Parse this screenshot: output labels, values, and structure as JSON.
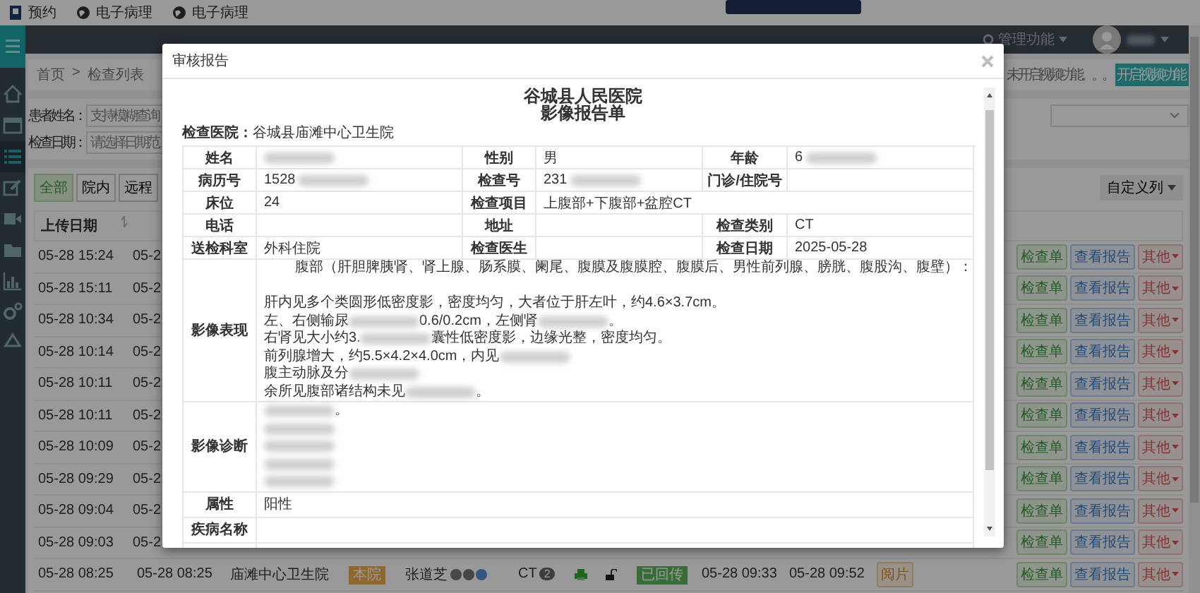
{
  "browser_bar": {
    "bookmarks": [
      {
        "kind": "app",
        "label": "预约"
      },
      {
        "kind": "globe",
        "label": "电子病理"
      },
      {
        "kind": "globe",
        "label": "电子病理"
      }
    ]
  },
  "header": {
    "menu": "管理功能"
  },
  "sidebar": {
    "items": [
      {
        "kind": "home",
        "selected": false
      },
      {
        "kind": "window",
        "selected": false
      },
      {
        "kind": "list",
        "selected": true
      },
      {
        "kind": "edit",
        "selected": false
      },
      {
        "kind": "video",
        "selected": false
      },
      {
        "kind": "folder",
        "selected": false
      },
      {
        "kind": "chart",
        "selected": false
      },
      {
        "kind": "gears",
        "selected": false
      },
      {
        "kind": "recycle",
        "selected": false
      }
    ]
  },
  "breadcrumb": {
    "items": [
      "首页",
      "检查列表"
    ],
    "separator": ">"
  },
  "video_notice": {
    "text": "未开启视频功能。。。",
    "button": "开启视频功能"
  },
  "search": {
    "fields": [
      {
        "label": "患者姓名：",
        "placeholder": "支持模糊查询"
      },
      {
        "label": "检查日期：",
        "placeholder": "请选择日期范"
      }
    ]
  },
  "filters": [
    {
      "label": "全部",
      "selected": true
    },
    {
      "label": "院内",
      "selected": false
    },
    {
      "label": "远程",
      "selected": false
    }
  ],
  "column_menu": "自定义列",
  "table": {
    "columns": [
      "上传日期"
    ],
    "rows": [
      {
        "upload": "05-28 15:24",
        "col_2": "05-2",
        "actions": [
          "检查单",
          "查看报告",
          "其他"
        ]
      },
      {
        "upload": "05-28 15:11",
        "col_2": "05-2",
        "actions": [
          "检查单",
          "查看报告",
          "其他"
        ]
      },
      {
        "upload": "05-28 10:34",
        "col_2": "05-2",
        "actions": [
          "检查单",
          "查看报告",
          "其他"
        ]
      },
      {
        "upload": "05-28 10:14",
        "col_2": "05-2",
        "actions": [
          "检查单",
          "查看报告",
          "其他"
        ]
      },
      {
        "upload": "05-28 10:11",
        "col_2": "05-2",
        "actions": [
          "检查单",
          "查看报告",
          "其他"
        ]
      },
      {
        "upload": "05-28 10:11",
        "col_2": "05-2",
        "actions": [
          "检查单",
          "查看报告",
          "其他"
        ]
      },
      {
        "upload": "05-28 10:09",
        "col_2": "05-2",
        "actions": [
          "检查单",
          "查看报告",
          "其他"
        ]
      },
      {
        "upload": "05-28 09:29",
        "col_2": "05-2",
        "actions": [
          "检查单",
          "查看报告",
          "其他"
        ]
      },
      {
        "upload": "05-28 09:04",
        "col_2": "05-2",
        "actions": [
          "检查单",
          "查看报告",
          "其他"
        ]
      },
      {
        "upload": "05-28 09:03",
        "col_2": "05-2",
        "actions": [
          "检查单",
          "查看报告",
          "其他"
        ]
      }
    ],
    "full_row": {
      "upload": "05-28 08:25",
      "exam_time": "05-28 08:25",
      "hospital": "庙滩中心卫生院",
      "source": "本院",
      "patient": "张道芝",
      "modality": "CT",
      "count": "2",
      "status": "已回传",
      "time_1": "05-28 09:33",
      "time_2": "05-28 09:52",
      "review": "阅片",
      "actions": [
        "检查单",
        "查看报告",
        "其他"
      ]
    }
  },
  "dialog": {
    "title": "审核报告",
    "heading": [
      "谷城县人民医院",
      "影像报告单"
    ],
    "hospital": {
      "label": "检查医院：",
      "value": "谷城县庙滩中心卫生院"
    },
    "info_rows": [
      [
        {
          "label": "姓名",
          "redacted": true
        },
        {
          "label": "性别",
          "value": "男",
          "redacted": false
        },
        {
          "label": "年龄",
          "value": "6",
          "redacted": true
        }
      ],
      [
        {
          "label": "病历号",
          "value": "1528",
          "redacted": true
        },
        {
          "label": "检查号",
          "value": "231",
          "redacted": true
        },
        {
          "label": "门诊/住院号",
          "redacted": false
        }
      ],
      [
        {
          "label": "床位",
          "value": "24",
          "redacted": false
        },
        {
          "label": "检查项目",
          "value": "上腹部+下腹部+盆腔CT",
          "redacted": false,
          "wide": true
        }
      ],
      [
        {
          "label": "电话",
          "redacted": false
        },
        {
          "label": "地址",
          "redacted": false
        },
        {
          "label": "检查类别",
          "value": "CT",
          "redacted": false
        }
      ],
      [
        {
          "label": "送检科室",
          "value": "外科住院",
          "redacted": false
        },
        {
          "label": "检查医生",
          "redacted": false
        },
        {
          "label": "检查日期",
          "value": "2025-05-28",
          "redacted": false
        }
      ]
    ],
    "findings": {
      "label": "影像表现",
      "lines": [
        {
          "kind": "text",
          "indent": true,
          "segments": [
            {
              "kind": "text",
              "text": "腹部（肝胆脾胰肾、肾上腺、肠系膜、阑尾、腹膜及腹膜腔、腹膜后、男性前列腺、膀胱、腹股沟、腹壁）："
            }
          ]
        },
        {
          "kind": "blank"
        },
        {
          "kind": "text",
          "indent": false,
          "segments": [
            {
              "kind": "text",
              "text": "肝内见多个类圆形低密度影，密度均匀，大者位于肝左叶，约4.6×3.7cm。"
            }
          ]
        },
        {
          "kind": "text",
          "indent": false,
          "segments": [
            {
              "kind": "text",
              "text": "左、右侧输尿"
            },
            {
              "kind": "blur"
            },
            {
              "kind": "text",
              "text": "0.6/0.2cm，左侧肾"
            },
            {
              "kind": "blur"
            },
            {
              "kind": "text",
              "text": "。"
            }
          ]
        },
        {
          "kind": "text",
          "indent": false,
          "segments": [
            {
              "kind": "text",
              "text": "右肾见大小约3."
            },
            {
              "kind": "blur"
            },
            {
              "kind": "text",
              "text": "囊性低密度影，边缘光整，密度均匀。"
            }
          ]
        },
        {
          "kind": "text",
          "indent": false,
          "segments": [
            {
              "kind": "text",
              "text": "前列腺增大，约5.5×4.2×4.0cm，内见"
            },
            {
              "kind": "blur"
            }
          ]
        },
        {
          "kind": "text",
          "indent": false,
          "segments": [
            {
              "kind": "text",
              "text": "腹主动脉及分"
            },
            {
              "kind": "blur"
            }
          ]
        },
        {
          "kind": "text",
          "indent": false,
          "segments": [
            {
              "kind": "text",
              "text": "余所见腹部诸结构未见"
            },
            {
              "kind": "blur"
            },
            {
              "kind": "text",
              "text": "。"
            }
          ]
        }
      ]
    },
    "diagnosis": {
      "label": "影像诊断",
      "lines": [
        {
          "kind": "text",
          "indent": false,
          "segments": [
            {
              "kind": "blur"
            },
            {
              "kind": "text",
              "text": "。"
            }
          ]
        },
        {
          "kind": "text",
          "indent": false,
          "segments": [
            {
              "kind": "blur"
            }
          ]
        },
        {
          "kind": "text",
          "indent": false,
          "segments": [
            {
              "kind": "blur"
            }
          ]
        },
        {
          "kind": "text",
          "indent": false,
          "segments": [
            {
              "kind": "blur"
            }
          ]
        },
        {
          "kind": "text",
          "indent": false,
          "segments": [
            {
              "kind": "blur"
            }
          ]
        }
      ]
    },
    "attribute": {
      "label": "属性",
      "value": "阳性"
    },
    "disease": {
      "label": "疾病名称"
    }
  }
}
